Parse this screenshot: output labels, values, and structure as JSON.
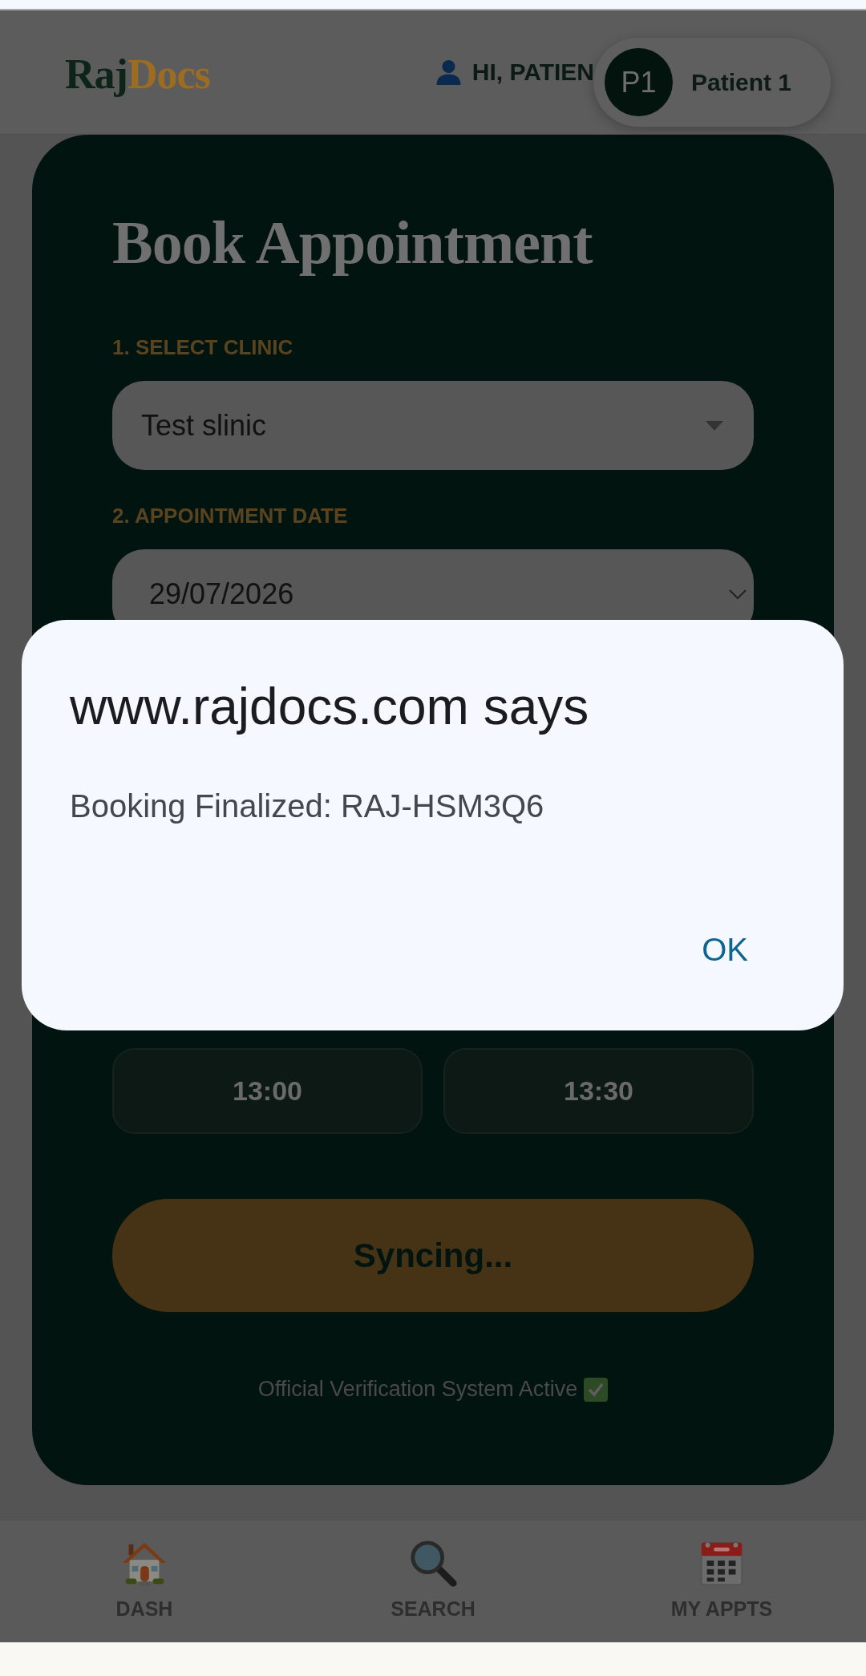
{
  "top_bar": {
    "logo": {
      "part_1": "Raj",
      "part_2": "Docs"
    },
    "greeting": "HI, PATIEN",
    "profile_chip": {
      "initials": "P1",
      "name": "Patient 1"
    }
  },
  "booking_card": {
    "title": "Book Appointment",
    "fields": [
      {
        "kind": "select",
        "label": "1. SELECT CLINIC",
        "value": "Test slinic"
      },
      {
        "kind": "date",
        "label": "2. APPOINTMENT DATE",
        "value": "29/07/2026"
      }
    ],
    "time_slots": [
      {
        "time": "13:00",
        "selected": false
      },
      {
        "time": "13:30",
        "selected": false
      }
    ],
    "submit_button": "Syncing...",
    "footer_note": "Official Verification System Active"
  },
  "alert_dialog": {
    "title": "www.rajdocs.com says",
    "message": "Booking Finalized: RAJ-HSM3Q6",
    "buttons": [
      "OK"
    ]
  },
  "bottom_nav": [
    {
      "label": "DASH"
    },
    {
      "label": "SEARCH"
    },
    {
      "label": "MY APPTS"
    }
  ]
}
